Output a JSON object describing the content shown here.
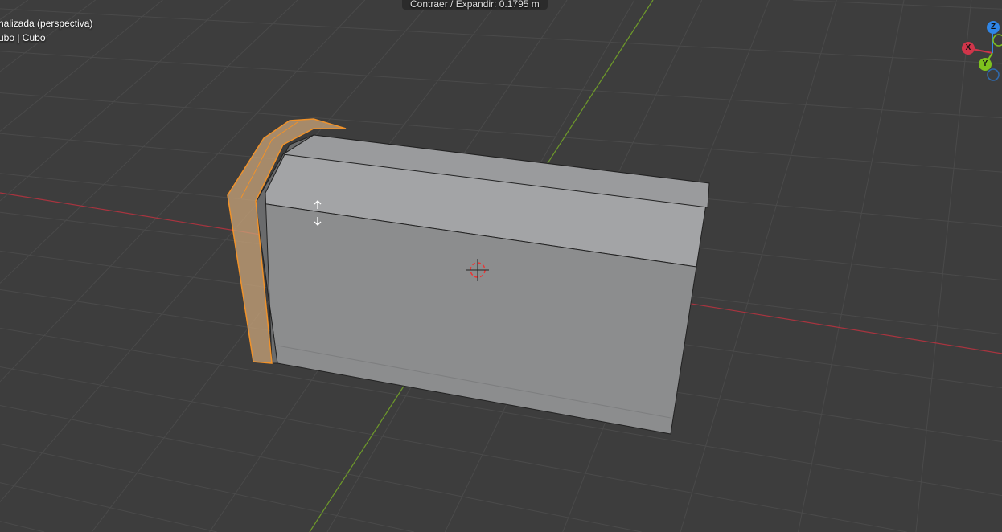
{
  "header": {
    "status": "Contraer / Expandir: 0.1795 m"
  },
  "overlay": {
    "view_name": "nalizada (perspectiva)",
    "object_name": "ubo | Cubo"
  },
  "gizmo": {
    "x_label": "X",
    "y_label": "Y",
    "z_label": "Z",
    "x_color": "#d0354a",
    "y_color": "#7ec21e",
    "z_color": "#2f86e8"
  },
  "colors": {
    "background": "#3d3d3d",
    "grid": "#4a4a4a",
    "x_axis": "#a8343f",
    "y_axis": "#6e9a2a",
    "selection": "#f0922a"
  }
}
